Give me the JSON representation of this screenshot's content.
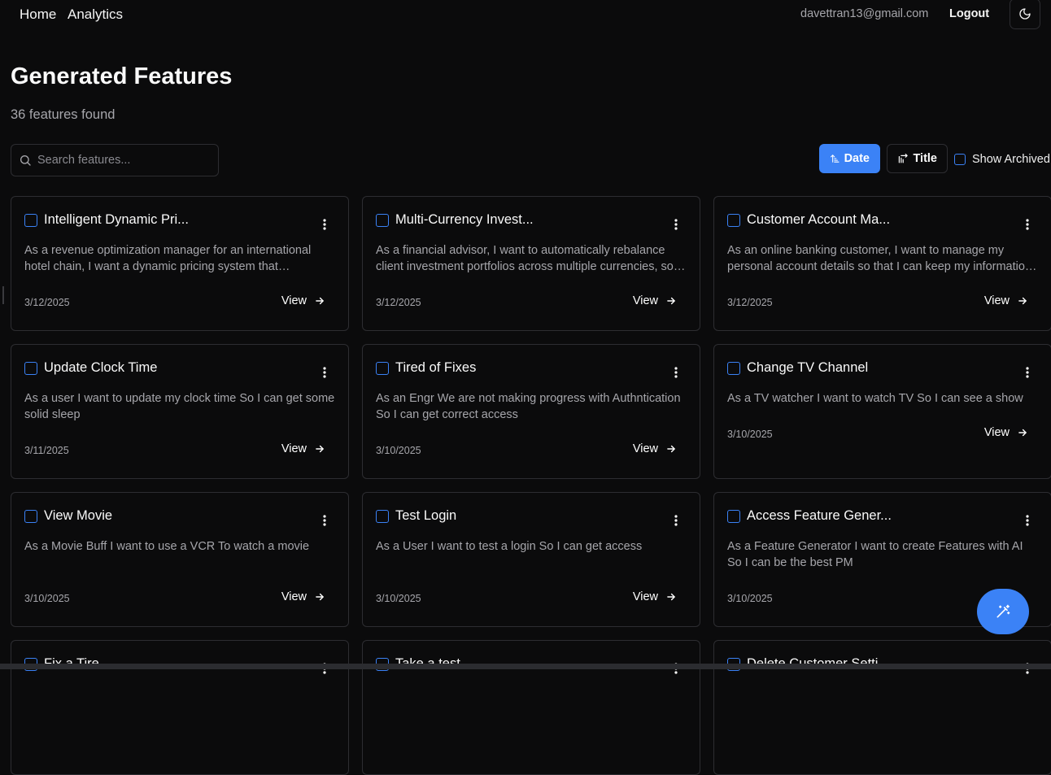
{
  "nav": {
    "home": "Home",
    "analytics": "Analytics",
    "email": "davettran13@gmail.com",
    "logout": "Logout"
  },
  "page": {
    "title": "Generated Features",
    "count_text": "36 features found"
  },
  "search": {
    "placeholder": "Search features..."
  },
  "sort": {
    "date": "Date",
    "title": "Title",
    "active": "date"
  },
  "show_archived": "Show Archived",
  "colors": {
    "accent": "#3b82f6",
    "background": "#0b0b0c",
    "border": "#2d2d31",
    "muted_text": "#a6a6ab"
  },
  "icons": {
    "theme": "moon-icon",
    "search": "search-icon",
    "menu": "dots-vertical-icon",
    "view": "arrow-right-icon",
    "fab": "magic-wand-icon"
  },
  "view_label": "View",
  "cards": [
    {
      "title": "Intelligent Dynamic Pri...",
      "description": "As a revenue optimization manager for an international hotel chain, I want a dynamic pricing system that automatically adjusts room rates",
      "date": "3/12/2025"
    },
    {
      "title": "Multi-Currency Invest...",
      "description": "As a financial advisor, I want to automatically rebalance client investment portfolios across multiple currencies, so that allocations stay on target",
      "date": "3/12/2025"
    },
    {
      "title": "Customer Account Ma...",
      "description": "As an online banking customer, I want to manage my personal account details so that I can keep my information up to date",
      "date": "3/12/2025"
    },
    {
      "title": "Update Clock Time",
      "description": "As a user I want to update my clock time So I can get some solid sleep",
      "date": "3/11/2025"
    },
    {
      "title": "Tired of Fixes",
      "description": "As an Engr We are not making progress with Authntication So I can get correct access",
      "date": "3/10/2025"
    },
    {
      "title": "Change TV Channel",
      "description": "As a TV watcher I want to watch TV So I can see a show",
      "date": "3/10/2025"
    },
    {
      "title": "View Movie",
      "description": "As a Movie Buff I want to use a VCR To watch a movie",
      "date": "3/10/2025"
    },
    {
      "title": "Test Login",
      "description": "As a User I want to test a login So I can get access",
      "date": "3/10/2025"
    },
    {
      "title": "Access Feature Gener...",
      "description": "As a Feature Generator I want to create Features with AI So I can be the best PM",
      "date": "3/10/2025"
    },
    {
      "title": "Fix a Tire",
      "description": "",
      "date": ""
    },
    {
      "title": "Take a test",
      "description": "",
      "date": ""
    },
    {
      "title": "Delete Customer Setti...",
      "description": "",
      "date": ""
    }
  ]
}
